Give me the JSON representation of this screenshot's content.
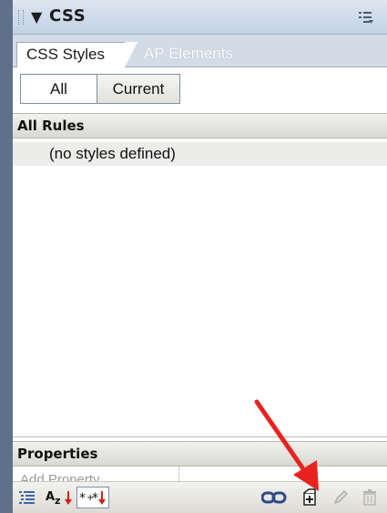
{
  "panel": {
    "title": "CSS",
    "collapse_icon": "triangle-down-icon",
    "options_icon": "panel-options-icon"
  },
  "tabs": [
    {
      "label": "CSS Styles",
      "active": true
    },
    {
      "label": "AP Elements",
      "active": false
    }
  ],
  "mode_toggle": {
    "all_label": "All",
    "current_label": "Current",
    "selected": "All"
  },
  "rules": {
    "header": "All Rules",
    "items": [
      {
        "label": "(no styles defined)"
      }
    ]
  },
  "properties": {
    "header": "Properties",
    "add_property_label": "Add Property"
  },
  "toolbar": {
    "left_buttons": [
      {
        "icon": "category-view-icon"
      },
      {
        "icon": "alphabetical-view-icon",
        "glyph": "Az"
      },
      {
        "icon": "set-properties-view-icon",
        "glyph": "**"
      }
    ],
    "right_buttons": [
      {
        "icon": "attach-style-sheet-icon"
      },
      {
        "icon": "new-css-rule-icon"
      },
      {
        "icon": "edit-style-icon"
      },
      {
        "icon": "delete-css-rule-icon"
      }
    ]
  },
  "colors": {
    "panel_strip": "#5f7189",
    "titlebar": "#c2d1e3",
    "annotation_arrow": "#e8231f",
    "sort_arrow": "#d2201a"
  }
}
